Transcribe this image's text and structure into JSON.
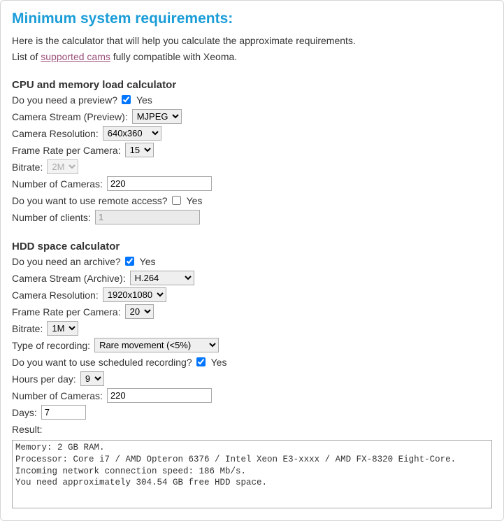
{
  "title": "Minimum system requirements:",
  "intro": {
    "line1": "Here is the calculator that will help you calculate the approximate requirements.",
    "line2a": "List of ",
    "link_text": "supported cams",
    "line2b": " fully compatible with Xeoma."
  },
  "cpu": {
    "heading": "CPU and memory load calculator",
    "preview_label": "Do you need a preview?",
    "preview_checked": true,
    "yes": "Yes",
    "stream_label": "Camera Stream (Preview):",
    "stream_value": "MJPEG",
    "resolution_label": "Camera Resolution:",
    "resolution_value": "640x360",
    "fps_label": "Frame Rate per Camera:",
    "fps_value": "15",
    "bitrate_label": "Bitrate:",
    "bitrate_value": "2M",
    "num_cams_label": "Number of Cameras:",
    "num_cams_value": "220",
    "remote_label": "Do you want to use remote access?",
    "remote_checked": false,
    "clients_label": "Number of clients:",
    "clients_value": "1"
  },
  "hdd": {
    "heading": "HDD space calculator",
    "archive_label": "Do you need an archive?",
    "archive_checked": true,
    "yes": "Yes",
    "stream_label": "Camera Stream (Archive):",
    "stream_value": "H.264",
    "resolution_label": "Camera Resolution:",
    "resolution_value": "1920x1080",
    "fps_label": "Frame Rate per Camera:",
    "fps_value": "20",
    "bitrate_label": "Bitrate:",
    "bitrate_value": "1M",
    "record_type_label": "Type of recording:",
    "record_type_value": "Rare movement (<5%)",
    "scheduled_label": "Do you want to use scheduled recording?",
    "scheduled_checked": true,
    "hours_label": "Hours per day:",
    "hours_value": "9",
    "num_cams_label": "Number of Cameras:",
    "num_cams_value": "220",
    "days_label": "Days:",
    "days_value": "7"
  },
  "result": {
    "label": "Result:",
    "text": "Memory: 2 GB RAM.\nProcessor: Core i7 / AMD Opteron 6376 / Intel Xeon E3-xxxx / AMD FX-8320 Eight-Core.\nIncoming network connection speed: 186 Mb/s.\nYou need approximately 304.54 GB free HDD space."
  }
}
